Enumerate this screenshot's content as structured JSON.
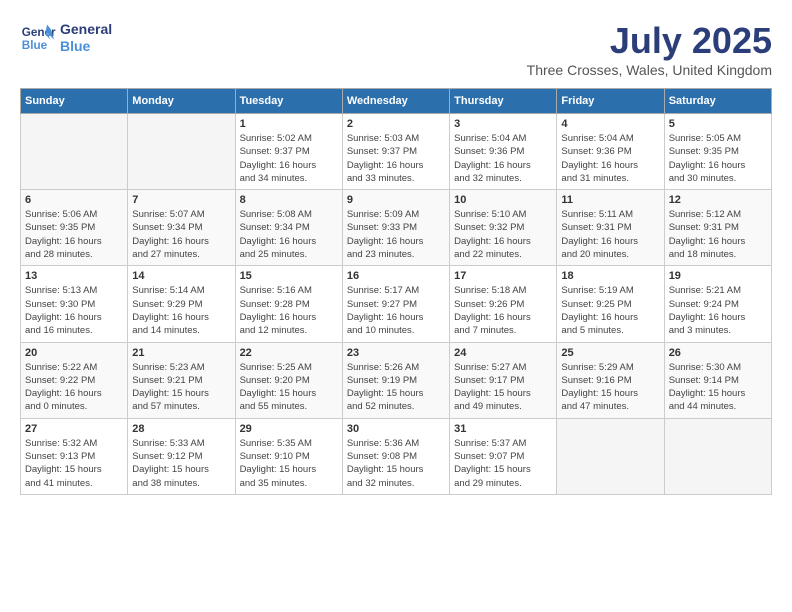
{
  "logo": {
    "line1": "General",
    "line2": "Blue"
  },
  "title": "July 2025",
  "location": "Three Crosses, Wales, United Kingdom",
  "days_of_week": [
    "Sunday",
    "Monday",
    "Tuesday",
    "Wednesday",
    "Thursday",
    "Friday",
    "Saturday"
  ],
  "weeks": [
    [
      {
        "num": "",
        "info": ""
      },
      {
        "num": "",
        "info": ""
      },
      {
        "num": "1",
        "info": "Sunrise: 5:02 AM\nSunset: 9:37 PM\nDaylight: 16 hours\nand 34 minutes."
      },
      {
        "num": "2",
        "info": "Sunrise: 5:03 AM\nSunset: 9:37 PM\nDaylight: 16 hours\nand 33 minutes."
      },
      {
        "num": "3",
        "info": "Sunrise: 5:04 AM\nSunset: 9:36 PM\nDaylight: 16 hours\nand 32 minutes."
      },
      {
        "num": "4",
        "info": "Sunrise: 5:04 AM\nSunset: 9:36 PM\nDaylight: 16 hours\nand 31 minutes."
      },
      {
        "num": "5",
        "info": "Sunrise: 5:05 AM\nSunset: 9:35 PM\nDaylight: 16 hours\nand 30 minutes."
      }
    ],
    [
      {
        "num": "6",
        "info": "Sunrise: 5:06 AM\nSunset: 9:35 PM\nDaylight: 16 hours\nand 28 minutes."
      },
      {
        "num": "7",
        "info": "Sunrise: 5:07 AM\nSunset: 9:34 PM\nDaylight: 16 hours\nand 27 minutes."
      },
      {
        "num": "8",
        "info": "Sunrise: 5:08 AM\nSunset: 9:34 PM\nDaylight: 16 hours\nand 25 minutes."
      },
      {
        "num": "9",
        "info": "Sunrise: 5:09 AM\nSunset: 9:33 PM\nDaylight: 16 hours\nand 23 minutes."
      },
      {
        "num": "10",
        "info": "Sunrise: 5:10 AM\nSunset: 9:32 PM\nDaylight: 16 hours\nand 22 minutes."
      },
      {
        "num": "11",
        "info": "Sunrise: 5:11 AM\nSunset: 9:31 PM\nDaylight: 16 hours\nand 20 minutes."
      },
      {
        "num": "12",
        "info": "Sunrise: 5:12 AM\nSunset: 9:31 PM\nDaylight: 16 hours\nand 18 minutes."
      }
    ],
    [
      {
        "num": "13",
        "info": "Sunrise: 5:13 AM\nSunset: 9:30 PM\nDaylight: 16 hours\nand 16 minutes."
      },
      {
        "num": "14",
        "info": "Sunrise: 5:14 AM\nSunset: 9:29 PM\nDaylight: 16 hours\nand 14 minutes."
      },
      {
        "num": "15",
        "info": "Sunrise: 5:16 AM\nSunset: 9:28 PM\nDaylight: 16 hours\nand 12 minutes."
      },
      {
        "num": "16",
        "info": "Sunrise: 5:17 AM\nSunset: 9:27 PM\nDaylight: 16 hours\nand 10 minutes."
      },
      {
        "num": "17",
        "info": "Sunrise: 5:18 AM\nSunset: 9:26 PM\nDaylight: 16 hours\nand 7 minutes."
      },
      {
        "num": "18",
        "info": "Sunrise: 5:19 AM\nSunset: 9:25 PM\nDaylight: 16 hours\nand 5 minutes."
      },
      {
        "num": "19",
        "info": "Sunrise: 5:21 AM\nSunset: 9:24 PM\nDaylight: 16 hours\nand 3 minutes."
      }
    ],
    [
      {
        "num": "20",
        "info": "Sunrise: 5:22 AM\nSunset: 9:22 PM\nDaylight: 16 hours\nand 0 minutes."
      },
      {
        "num": "21",
        "info": "Sunrise: 5:23 AM\nSunset: 9:21 PM\nDaylight: 15 hours\nand 57 minutes."
      },
      {
        "num": "22",
        "info": "Sunrise: 5:25 AM\nSunset: 9:20 PM\nDaylight: 15 hours\nand 55 minutes."
      },
      {
        "num": "23",
        "info": "Sunrise: 5:26 AM\nSunset: 9:19 PM\nDaylight: 15 hours\nand 52 minutes."
      },
      {
        "num": "24",
        "info": "Sunrise: 5:27 AM\nSunset: 9:17 PM\nDaylight: 15 hours\nand 49 minutes."
      },
      {
        "num": "25",
        "info": "Sunrise: 5:29 AM\nSunset: 9:16 PM\nDaylight: 15 hours\nand 47 minutes."
      },
      {
        "num": "26",
        "info": "Sunrise: 5:30 AM\nSunset: 9:14 PM\nDaylight: 15 hours\nand 44 minutes."
      }
    ],
    [
      {
        "num": "27",
        "info": "Sunrise: 5:32 AM\nSunset: 9:13 PM\nDaylight: 15 hours\nand 41 minutes."
      },
      {
        "num": "28",
        "info": "Sunrise: 5:33 AM\nSunset: 9:12 PM\nDaylight: 15 hours\nand 38 minutes."
      },
      {
        "num": "29",
        "info": "Sunrise: 5:35 AM\nSunset: 9:10 PM\nDaylight: 15 hours\nand 35 minutes."
      },
      {
        "num": "30",
        "info": "Sunrise: 5:36 AM\nSunset: 9:08 PM\nDaylight: 15 hours\nand 32 minutes."
      },
      {
        "num": "31",
        "info": "Sunrise: 5:37 AM\nSunset: 9:07 PM\nDaylight: 15 hours\nand 29 minutes."
      },
      {
        "num": "",
        "info": ""
      },
      {
        "num": "",
        "info": ""
      }
    ]
  ]
}
